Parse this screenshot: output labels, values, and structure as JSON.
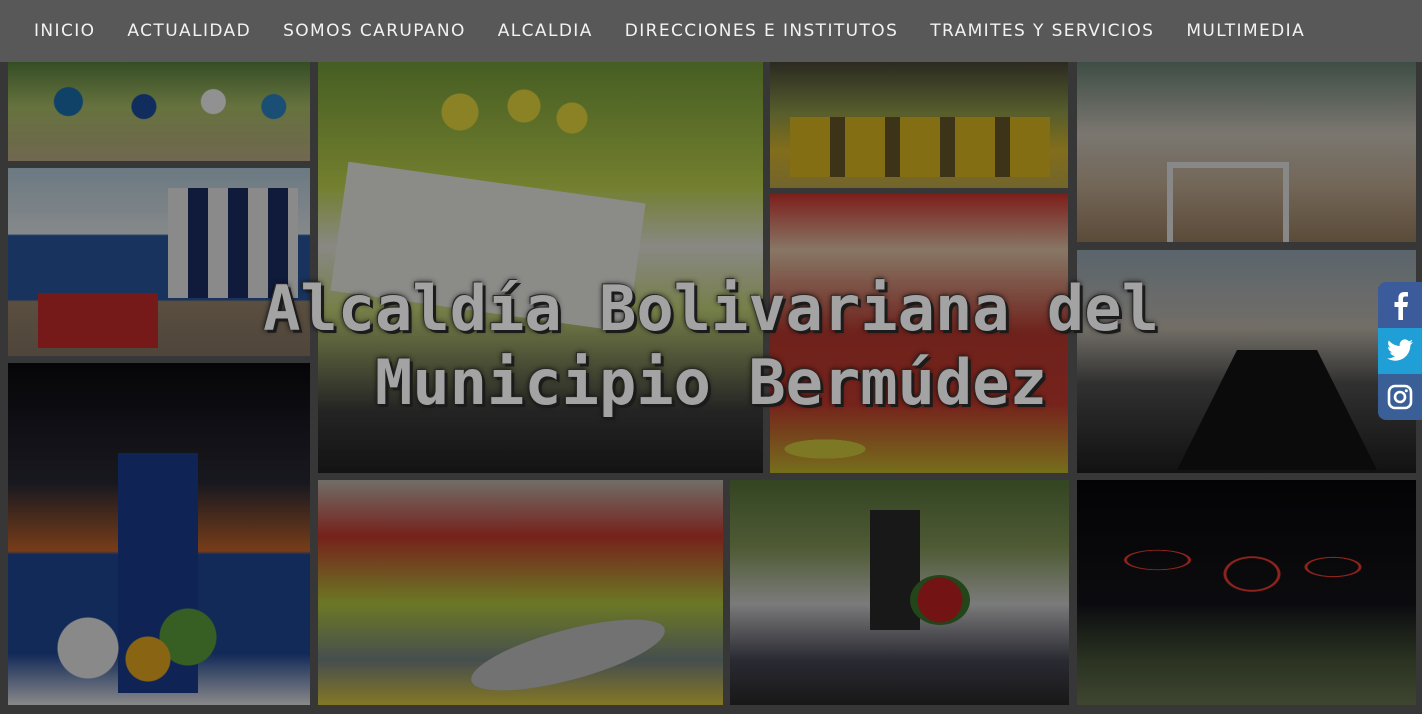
{
  "nav": {
    "items": [
      {
        "label": "INICIO"
      },
      {
        "label": "ACTUALIDAD"
      },
      {
        "label": "SOMOS CARUPANO"
      },
      {
        "label": "ALCALDIA"
      },
      {
        "label": "DIRECCIONES E INSTITUTOS"
      },
      {
        "label": "TRAMITES Y SERVICIOS"
      },
      {
        "label": "MULTIMEDIA"
      }
    ]
  },
  "hero": {
    "title_line1": "Alcaldía Bolivariana del",
    "title_line2": "Municipio Bermúdez"
  },
  "social": {
    "items": [
      {
        "icon": "facebook-icon",
        "color": "#3b5b9a"
      },
      {
        "icon": "twitter-icon",
        "color": "#1f9fd6"
      },
      {
        "icon": "instagram-icon",
        "color": "#3a5e96"
      }
    ]
  },
  "colors": {
    "navbar": "#5a5a5a",
    "nav_text": "#f2f2f2",
    "title_text": "#a3a3a3"
  }
}
